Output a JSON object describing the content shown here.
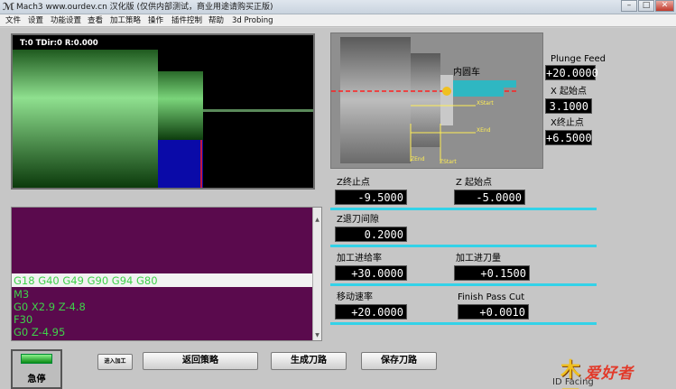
{
  "window": {
    "title": "Mach3 www.ourdev.cn 汉化版 (仅供内部测试，商业用途请购买正版)",
    "app_icon": "mach3-icon"
  },
  "menu": [
    "文件",
    "设置",
    "功能设置",
    "查看",
    "加工策略",
    "操作",
    "插件控制",
    "帮助",
    "3d Probing"
  ],
  "toolpath": {
    "readout": "T:0 TDir:0 R:0.000"
  },
  "gcode": {
    "lines": [
      "G18 G40 G49 G90 G94 G80",
      "M3",
      "G0 X2.9 Z-4.8",
      "F30",
      "G0 Z-4.95"
    ],
    "current_index": 0
  },
  "diagram": {
    "label_title": "内圆车",
    "label_xstart": "XStart",
    "label_xend": "XEnd",
    "label_zend": "ZEnd",
    "label_zstart": "ZStart",
    "accent": "#2fb7c2"
  },
  "fields": {
    "plunge_feed": {
      "label": "Plunge Feed",
      "value": "+20.0000"
    },
    "x_start": {
      "label": "X 起始点",
      "value": "3.1000"
    },
    "x_end": {
      "label": "X终止点",
      "value": "+6.5000"
    },
    "z_end": {
      "label": "Z终止点",
      "value": "-9.5000"
    },
    "z_start": {
      "label": "Z 起始点",
      "value": "-5.0000"
    },
    "z_retract": {
      "label": "Z退刀间隙",
      "value": "0.2000"
    },
    "feed_rate": {
      "label": "加工进给率",
      "value": "+30.0000"
    },
    "cut_amount": {
      "label": "加工进刀量",
      "value": "+0.1500"
    },
    "move_speed": {
      "label": "移动速率",
      "value": "+20.0000"
    },
    "finish_pass": {
      "label": "Finish Pass Cut",
      "value": "+0.0010"
    }
  },
  "buttons": {
    "estop": "急停",
    "load": "进入加工",
    "return": "返回策略",
    "generate": "生成刀路",
    "save": "保存刀路"
  },
  "logo": {
    "mark": "木工",
    "text": "爱好者"
  },
  "footer": {
    "id_facing": "ID Facing"
  }
}
